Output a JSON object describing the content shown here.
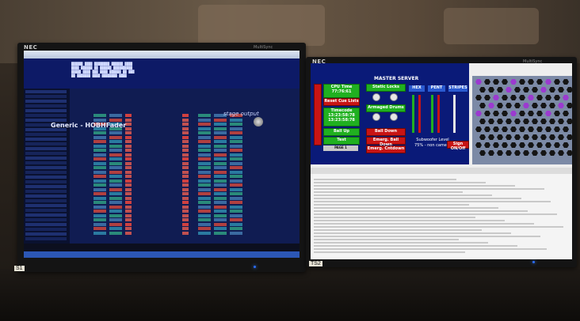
{
  "left_monitor": {
    "brand": "NEC",
    "model": "MultiSync",
    "sticker": "S1",
    "window_title": "Generic - HOBHFader",
    "logo_text": "stage output"
  },
  "right_monitor": {
    "brand": "NEC",
    "model": "MultiSync",
    "sticker": "TS2",
    "master_server": {
      "title": "MASTER SERVER",
      "cpu_time_label": "CPU Time",
      "cpu_time_value": "77:76:61",
      "reset_cue_lists": "Reset Cue Lists",
      "timecode_label": "Timecode",
      "timecode_a": "13:23:58:78",
      "timecode_b": "13:23:58:78",
      "ball_up": "Ball Up",
      "test": "Test",
      "page": "PAGE 1",
      "static_locks": "Static Locks",
      "armaged_drums": "Armaged Drums",
      "ball_down": "Ball Down",
      "emerg_ball_down": "Emerg. Ball Down",
      "emerg_cntdown": "Emerg. Cntdown",
      "fader_groups": [
        "HEX",
        "PENT",
        "STRIPES"
      ],
      "subwoofer_level": "Subwoofer Level",
      "subwoofer_note": "75% - non camera",
      "sign_on_off": "Sign ON/Off"
    }
  },
  "colors": {
    "wall": "#4a3f33",
    "left_bg": "#0b1440",
    "master_bg": "#0a1a78",
    "green": "#20b020",
    "red": "#c81414",
    "hex_purple": "#9c3ad0",
    "led_blue": "#2a6cff"
  }
}
